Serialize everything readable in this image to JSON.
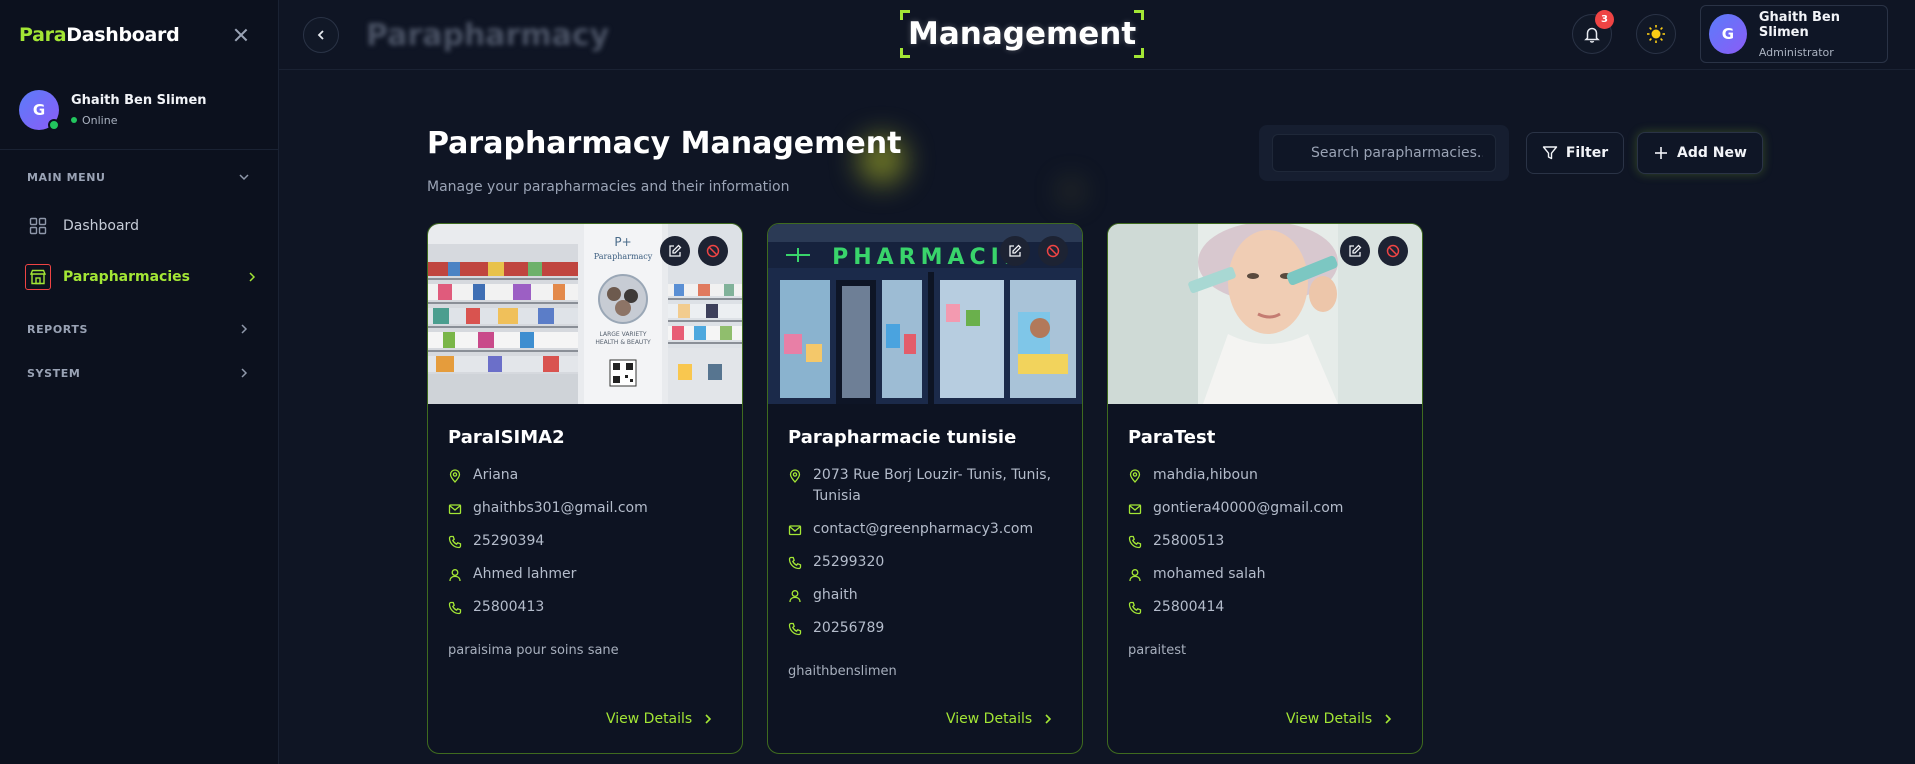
{
  "sidebar": {
    "brand_accent": "Para",
    "brand_rest": "Dashboard",
    "user": {
      "initial": "G",
      "name": "Ghaith Ben Slimen",
      "status": "Online"
    },
    "main_menu_label": "MAIN MENU",
    "items": [
      {
        "label": "Dashboard",
        "icon": "grid-icon",
        "active": false
      },
      {
        "label": "Parapharmacies",
        "icon": "store-icon",
        "active": true
      }
    ],
    "reports_label": "REPORTS",
    "system_label": "SYSTEM"
  },
  "topbar": {
    "breadcrumb_faded": "Parapharmacy",
    "breadcrumb_current": "Management",
    "notification_count": "3",
    "user": {
      "initial": "G",
      "name": "Ghaith Ben Slimen",
      "role": "Administrator"
    }
  },
  "main": {
    "title": "Parapharmacy Management",
    "subtitle": "Manage your parapharmacies and their information",
    "search_placeholder": "Search parapharmacies...",
    "filter_label": "Filter",
    "add_label": "Add New"
  },
  "cards": [
    {
      "name": "ParaISIMA2",
      "location": "Ariana",
      "email": "ghaithbs301@gmail.com",
      "phone": "25290394",
      "manager": "Ahmed lahmer",
      "manager_phone": "25800413",
      "description": "paraisima pour soins sane",
      "view_label": "View Details"
    },
    {
      "name": "Parapharmacie tunisie",
      "location": "2073 Rue Borj Louzir- Tunis, Tunis, Tunisia",
      "email": "contact@greenpharmacy3.com",
      "phone": "25299320",
      "manager": "ghaith",
      "manager_phone": "20256789",
      "description": "ghaithbenslimen",
      "view_label": "View Details",
      "sign_text": "PHARMACIE"
    },
    {
      "name": "ParaTest",
      "location": "mahdia,hiboun",
      "email": "gontiera40000@gmail.com",
      "phone": "25800513",
      "manager": "mohamed salah",
      "manager_phone": "25800414",
      "description": "paraitest",
      "view_label": "View Details"
    }
  ],
  "colors": {
    "accent": "#a3e635",
    "background": "#0f1524",
    "danger": "#ef4444",
    "online": "#22c55e"
  }
}
